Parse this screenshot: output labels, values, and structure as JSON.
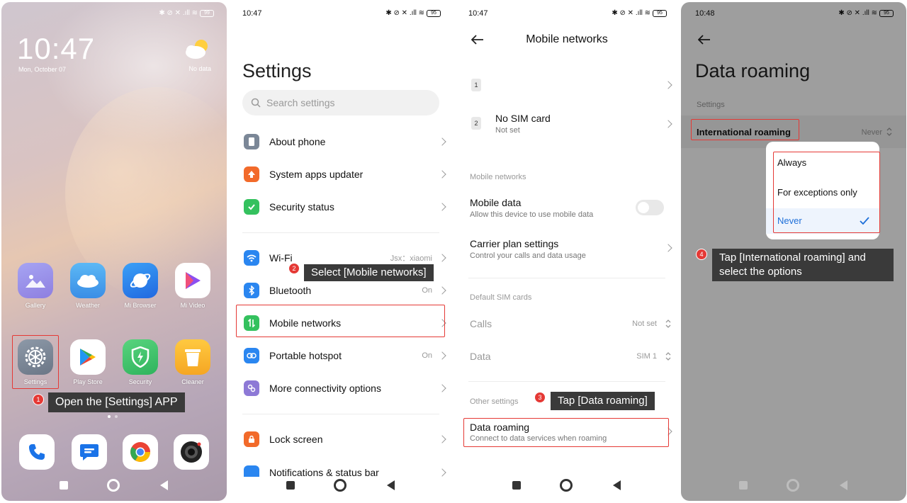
{
  "panel1": {
    "status_icons": "✱ ⊘ ✕ .ıll ≋",
    "battery": "99",
    "clock": "10:47",
    "date": "Mon, October 07",
    "weather_label": "No data",
    "apps_row1": [
      {
        "label": "Gallery",
        "color": "#8e88e8"
      },
      {
        "label": "Weather",
        "color": "#4aa6ef"
      },
      {
        "label": "Mi Browser",
        "color": "#2f8ff0"
      },
      {
        "label": "Mi Video",
        "color": "#ffffff"
      }
    ],
    "apps_row2": [
      {
        "label": "Settings",
        "color": "#7a8696"
      },
      {
        "label": "Play Store",
        "color": "#ffffff"
      },
      {
        "label": "Security",
        "color": "#3ec16b"
      },
      {
        "label": "Cleaner",
        "color": "#f7b731"
      }
    ],
    "step": "1",
    "tip": "Open the [Settings] APP"
  },
  "panel2": {
    "time": "10:47",
    "battery": "95",
    "title": "Settings",
    "search_placeholder": "Search settings",
    "items": [
      {
        "label": "About phone",
        "value": "",
        "color": "#7b8797"
      },
      {
        "label": "System apps updater",
        "value": "",
        "color": "#f26a2a"
      },
      {
        "label": "Security status",
        "value": "",
        "color": "#34c15e"
      },
      {
        "label": "Wi-Fi",
        "value": "Jsx：xiaomi",
        "color": "#2a86f0"
      },
      {
        "label": "Bluetooth",
        "value": "On",
        "color": "#2a86f0"
      },
      {
        "label": "Mobile networks",
        "value": "",
        "color": "#34c15e"
      },
      {
        "label": "Portable hotspot",
        "value": "On",
        "color": "#2a86f0"
      },
      {
        "label": "More connectivity options",
        "value": "",
        "color": "#8d79d6"
      },
      {
        "label": "Lock screen",
        "value": "",
        "color": "#f26a2a"
      },
      {
        "label": "Notifications & status bar",
        "value": "",
        "color": "#2a86f0"
      }
    ],
    "step": "2",
    "tip": "Select [Mobile networks]"
  },
  "panel3": {
    "time": "10:47",
    "battery": "95",
    "title": "Mobile networks",
    "sim1_badge": "1",
    "sim2_badge": "2",
    "sim2_title": "No SIM card",
    "sim2_sub": "Not set",
    "section_mobile": "Mobile networks",
    "mobile_data_title": "Mobile data",
    "mobile_data_sub": "Allow this device to use mobile data",
    "mobile_data_on": false,
    "carrier_title": "Carrier plan settings",
    "carrier_sub": "Control your calls and data usage",
    "section_default": "Default SIM cards",
    "calls_label": "Calls",
    "calls_value": "Not set",
    "data_label": "Data",
    "data_value": "SIM 1",
    "section_other": "Other settings",
    "roaming_title": "Data roaming",
    "roaming_sub": "Connect to data services when roaming",
    "step": "3",
    "tip": "Tap [Data roaming]"
  },
  "panel4": {
    "time": "10:48",
    "battery": "95",
    "title": "Data roaming",
    "section": "Settings",
    "row_label": "International roaming",
    "row_value": "Never",
    "options": [
      "Always",
      "For exceptions only",
      "Never"
    ],
    "selected_option": "Never",
    "step": "4",
    "tip_line1": "Tap [International roaming] and",
    "tip_line2": "select the options"
  },
  "colors": {
    "accent": "#1e6fd9",
    "highlight_red": "#e53935",
    "tip_bg": "#3a3a3a"
  }
}
